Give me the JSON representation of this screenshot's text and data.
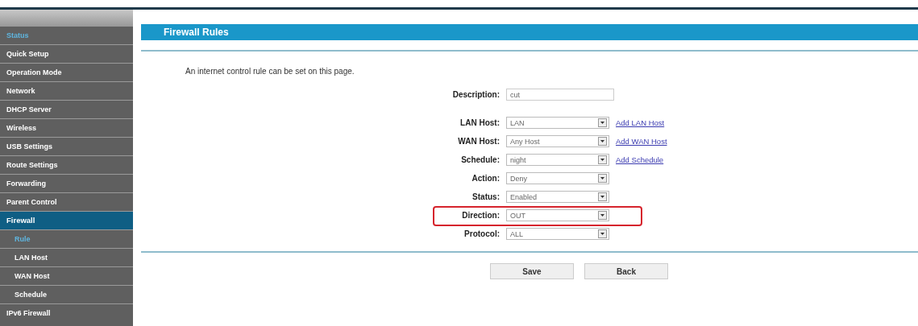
{
  "sidebar": {
    "items": [
      {
        "label": "Status",
        "selected": false,
        "highlighted": true
      },
      {
        "label": "Quick Setup",
        "selected": false,
        "highlighted": false
      },
      {
        "label": "Operation Mode",
        "selected": false,
        "highlighted": false
      },
      {
        "label": "Network",
        "selected": false,
        "highlighted": false
      },
      {
        "label": "DHCP Server",
        "selected": false,
        "highlighted": false
      },
      {
        "label": "Wireless",
        "selected": false,
        "highlighted": false
      },
      {
        "label": "USB Settings",
        "selected": false,
        "highlighted": false
      },
      {
        "label": "Route Settings",
        "selected": false,
        "highlighted": false
      },
      {
        "label": "Forwarding",
        "selected": false,
        "highlighted": false
      },
      {
        "label": "Parent Control",
        "selected": false,
        "highlighted": false
      },
      {
        "label": "Firewall",
        "selected": true,
        "highlighted": false,
        "children": [
          {
            "label": "Rule",
            "selected": false,
            "highlighted": true
          },
          {
            "label": "LAN Host",
            "selected": false,
            "highlighted": false
          },
          {
            "label": "WAN Host",
            "selected": false,
            "highlighted": false
          },
          {
            "label": "Schedule",
            "selected": false,
            "highlighted": false
          }
        ]
      },
      {
        "label": "IPv6 Firewall",
        "selected": false,
        "highlighted": false
      }
    ]
  },
  "header": {
    "title": "Firewall Rules"
  },
  "intro": "An internet control rule can be set on this page.",
  "form": [
    {
      "kind": "text",
      "label": "Description:",
      "value": "cut",
      "highlighted": false
    },
    {
      "kind": "select",
      "label": "LAN Host:",
      "value": "LAN",
      "link": "Add LAN Host",
      "highlighted": false
    },
    {
      "kind": "select",
      "label": "WAN Host:",
      "value": "Any Host",
      "link": "Add WAN Host",
      "highlighted": false
    },
    {
      "kind": "select",
      "label": "Schedule:",
      "value": "night",
      "link": "Add Schedule",
      "highlighted": false
    },
    {
      "kind": "select",
      "label": "Action:",
      "value": "Deny",
      "highlighted": false
    },
    {
      "kind": "select",
      "label": "Status:",
      "value": "Enabled",
      "highlighted": false
    },
    {
      "kind": "select",
      "label": "Direction:",
      "value": "OUT",
      "highlighted": true
    },
    {
      "kind": "select",
      "label": "Protocol:",
      "value": "ALL",
      "highlighted": false
    }
  ],
  "buttons": [
    "Save",
    "Back"
  ]
}
